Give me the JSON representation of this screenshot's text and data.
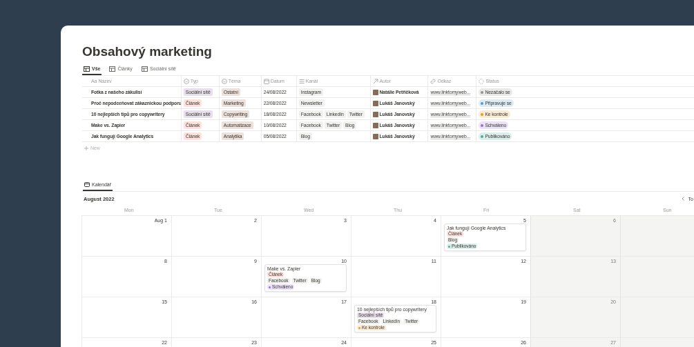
{
  "page": {
    "title": "Obsahový marketing"
  },
  "views": [
    {
      "label": "Vše",
      "selected": true
    },
    {
      "label": "Články",
      "selected": false
    },
    {
      "label": "Sociální sítě",
      "selected": false
    }
  ],
  "table": {
    "columns": [
      {
        "label": "Název",
        "kind": "title",
        "prefix": "Aa"
      },
      {
        "label": "Typ",
        "kind": "select"
      },
      {
        "label": "Téma",
        "kind": "select"
      },
      {
        "label": "Datum",
        "kind": "date"
      },
      {
        "label": "Kanál",
        "kind": "multi"
      },
      {
        "label": "Autor",
        "kind": "person"
      },
      {
        "label": "Odkaz",
        "kind": "url"
      },
      {
        "label": "Status",
        "kind": "status"
      }
    ],
    "rows": [
      {
        "name": "Fotka z našeho zákulisí",
        "type": {
          "label": "Sociální sítě",
          "color": "#e8deee"
        },
        "topic": "Ostatní",
        "date": "24/08/2022",
        "channels": [
          "Instagram"
        ],
        "author": "Natálie Petříčková",
        "link": "www.linktomyweb...",
        "status": {
          "label": "Nezačalo se",
          "color": "#91918e"
        }
      },
      {
        "name": "Proč nepodceňovat zákaznickou podporu",
        "type": {
          "label": "Článek",
          "color": "#ffe2dd"
        },
        "topic": "Marketing",
        "date": "22/08/2022",
        "channels": [
          "Newsletter"
        ],
        "author": "Lukáš Janovský",
        "link": "www.linktomyweb...",
        "status": {
          "label": "Připravuje se",
          "color": "#529cca"
        }
      },
      {
        "name": "10 nejlepších tipů pro copywritery",
        "type": {
          "label": "Sociální sítě",
          "color": "#e8deee"
        },
        "topic": "Copywriting",
        "date": "18/08/2022",
        "channels": [
          "Facebook",
          "LinkedIn",
          "Twitter"
        ],
        "author": "Lukáš Janovský",
        "link": "www.linktomyweb...",
        "status": {
          "label": "Ke kontrole",
          "color": "#e09a2f"
        }
      },
      {
        "name": "Make vs. Zapier",
        "type": {
          "label": "Článek",
          "color": "#ffe2dd"
        },
        "topic": "Automatizace",
        "date": "10/08/2022",
        "channels": [
          "Facebook",
          "Twitter",
          "Blog"
        ],
        "author": "Lukáš Janovský",
        "link": "www.linktomyweb...",
        "status": {
          "label": "Schváleno",
          "color": "#9a6dd7"
        }
      },
      {
        "name": "Jak fungují Google Analytics",
        "type": {
          "label": "Článek",
          "color": "#ffe2dd"
        },
        "topic": "Analytika",
        "date": "05/08/2022",
        "channels": [
          "Blog"
        ],
        "author": "Lukáš Janovský",
        "link": "www.linktomyweb...",
        "status": {
          "label": "Publikováno",
          "color": "#4dab9a"
        }
      }
    ],
    "new_label": "New"
  },
  "calendar": {
    "tab": {
      "label": "Kalendář",
      "selected": true
    },
    "month": "August 2022",
    "nav": "To",
    "weekdays": [
      {
        "label": "Mon",
        "weekend": false
      },
      {
        "label": "Tue",
        "weekend": false
      },
      {
        "label": "Wed",
        "weekend": false
      },
      {
        "label": "Thu",
        "weekend": false
      },
      {
        "label": "Fri",
        "weekend": false
      },
      {
        "label": "Sat",
        "weekend": true
      },
      {
        "label": "Sun",
        "weekend": true
      }
    ],
    "weeks": [
      {
        "days": [
          {
            "day": "Aug 1"
          },
          {
            "day": "2"
          },
          {
            "day": "3"
          },
          {
            "day": "4"
          },
          {
            "day": "5",
            "events": [
              {
                "title": "Jak fungují Google Analytics",
                "type": {
                  "label": "Článek",
                  "color": "#ffe2dd"
                },
                "channels": [
                  "Blog"
                ],
                "status": {
                  "label": "Publikováno",
                  "color": "#4dab9a"
                }
              }
            ]
          },
          {
            "day": "6"
          }
        ]
      },
      {
        "days": [
          {
            "day": "8"
          },
          {
            "day": "9"
          },
          {
            "day": "10",
            "events": [
              {
                "title": "Make vs. Zapier",
                "type": {
                  "label": "Článek",
                  "color": "#ffe2dd"
                },
                "channels": [
                  "Facebook",
                  "Twitter",
                  "Blog"
                ],
                "status": {
                  "label": "Schváleno",
                  "color": "#9a6dd7"
                }
              }
            ]
          },
          {
            "day": "11"
          },
          {
            "day": "12"
          },
          {
            "day": "13"
          }
        ]
      },
      {
        "days": [
          {
            "day": "15"
          },
          {
            "day": "16"
          },
          {
            "day": "17"
          },
          {
            "day": "18",
            "events": [
              {
                "title": "10 nejlepších tipů pro copywritery",
                "type": {
                  "label": "Sociální sítě",
                  "color": "#e8deee"
                },
                "channels": [
                  "Facebook",
                  "LinkedIn",
                  "Twitter"
                ],
                "status": {
                  "label": "Ke kontrole",
                  "color": "#e09a2f"
                }
              }
            ]
          },
          {
            "day": "19"
          },
          {
            "day": "20"
          }
        ]
      },
      {
        "days": [
          {
            "day": "22"
          },
          {
            "day": "23"
          },
          {
            "day": "24"
          },
          {
            "day": "25"
          },
          {
            "day": "26"
          },
          {
            "day": "27"
          }
        ]
      }
    ]
  }
}
